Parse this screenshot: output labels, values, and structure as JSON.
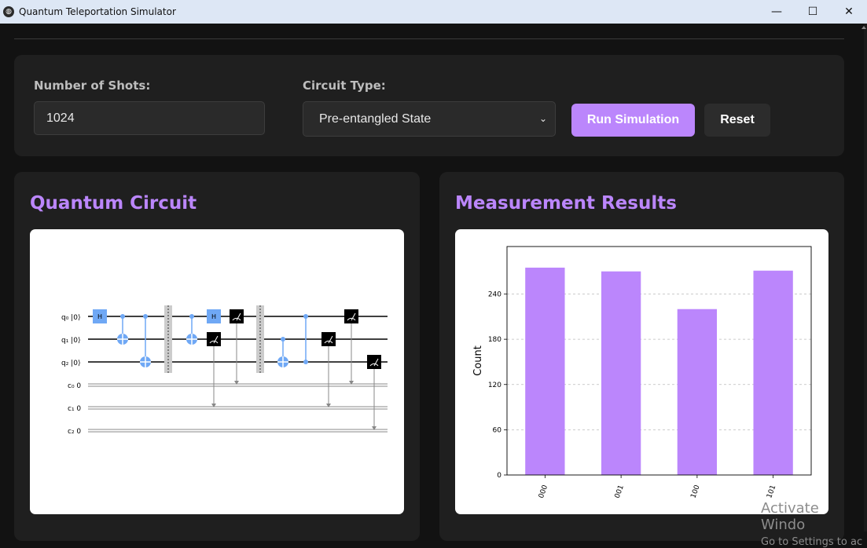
{
  "window": {
    "title": "Quantum Teleportation Simulator",
    "minimize": "—",
    "maximize": "☐",
    "close": "✕"
  },
  "controls": {
    "shots_label": "Number of Shots:",
    "shots_value": "1024",
    "circuit_type_label": "Circuit Type:",
    "circuit_type_selected": "Pre-entangled State",
    "run_button": "Run Simulation",
    "reset_button": "Reset"
  },
  "circuit_panel": {
    "title": "Quantum Circuit",
    "qubits": [
      "q₀ |0⟩",
      "q₁ |0⟩",
      "q₂ |0⟩"
    ],
    "clbits": [
      "c₀  0",
      "c₁  0",
      "c₂  0"
    ],
    "gate_h": "H"
  },
  "results_panel": {
    "title": "Measurement Results"
  },
  "chart_data": {
    "type": "bar",
    "categories": [
      "000",
      "001",
      "100",
      "101"
    ],
    "values": [
      275,
      270,
      220,
      271
    ],
    "title": "",
    "xlabel": "",
    "ylabel": "Count",
    "ylim": [
      0,
      303
    ],
    "yticks": [
      0,
      60,
      120,
      180,
      240
    ],
    "bar_color": "#bb86fc",
    "grid": "horizontal dashed"
  },
  "watermark": {
    "line1": "Activate Windo",
    "line2": "Go to Settings to ac"
  },
  "colors": {
    "accent": "#bb86fc",
    "background": "#121212",
    "panel": "#1f1f1f",
    "gate_blue": "#6fa8f5"
  }
}
